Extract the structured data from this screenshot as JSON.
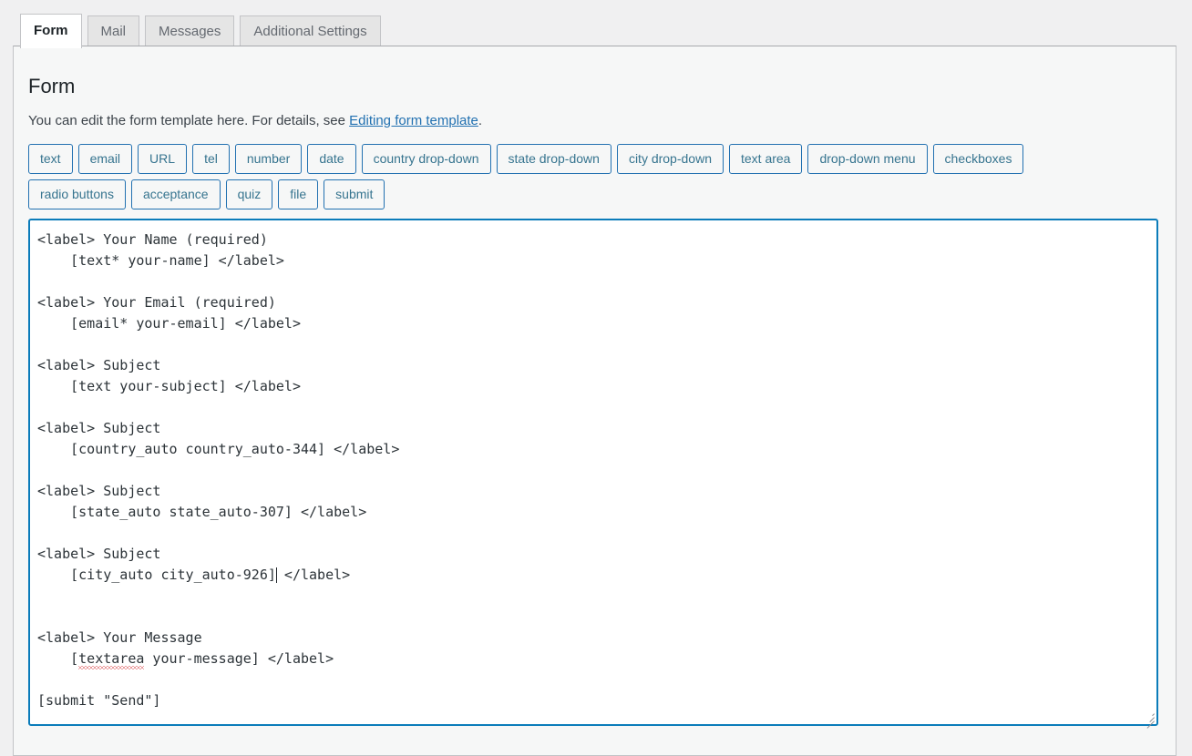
{
  "tabs": [
    {
      "label": "Form",
      "active": true
    },
    {
      "label": "Mail",
      "active": false
    },
    {
      "label": "Messages",
      "active": false
    },
    {
      "label": "Additional Settings",
      "active": false
    }
  ],
  "form_panel": {
    "title": "Form",
    "description_prefix": "You can edit the form template here. For details, see ",
    "description_link": "Editing form template",
    "description_suffix": ".",
    "tag_buttons": [
      "text",
      "email",
      "URL",
      "tel",
      "number",
      "date",
      "country drop-down",
      "state drop-down",
      "city drop-down",
      "text area",
      "drop-down menu",
      "checkboxes",
      "radio buttons",
      "acceptance",
      "quiz",
      "file",
      "submit"
    ],
    "editor": {
      "value": "<label> Your Name (required)\n    [text* your-name] </label>\n\n<label> Your Email (required)\n    [email* your-email] </label>\n\n<label> Subject\n    [text your-subject] </label>\n\n<label> Subject\n    [country_auto country_auto-344] </label>\n\n<label> Subject\n    [state_auto state_auto-307] </label>\n\n<label> Subject\n    [city_auto city_auto-926] </label>\n\n\n<label> Your Message\n    [textarea your-message] </label>\n\n[submit \"Send\"]",
      "misspelled_word": "textarea",
      "caret_after": "[city_auto city_auto-926]",
      "spellcheck_underline_color": "#d63638"
    }
  },
  "colors": {
    "accent": "#2271b1",
    "editor_border": "#0b7cba",
    "link": "#2271b1",
    "panel_bg": "#f6f7f7",
    "page_bg": "#f0f0f1",
    "tab_inactive_bg": "#e5e5e5",
    "tab_active_bg": "#ffffff",
    "text": "#3c434a",
    "heading": "#1d2327"
  }
}
